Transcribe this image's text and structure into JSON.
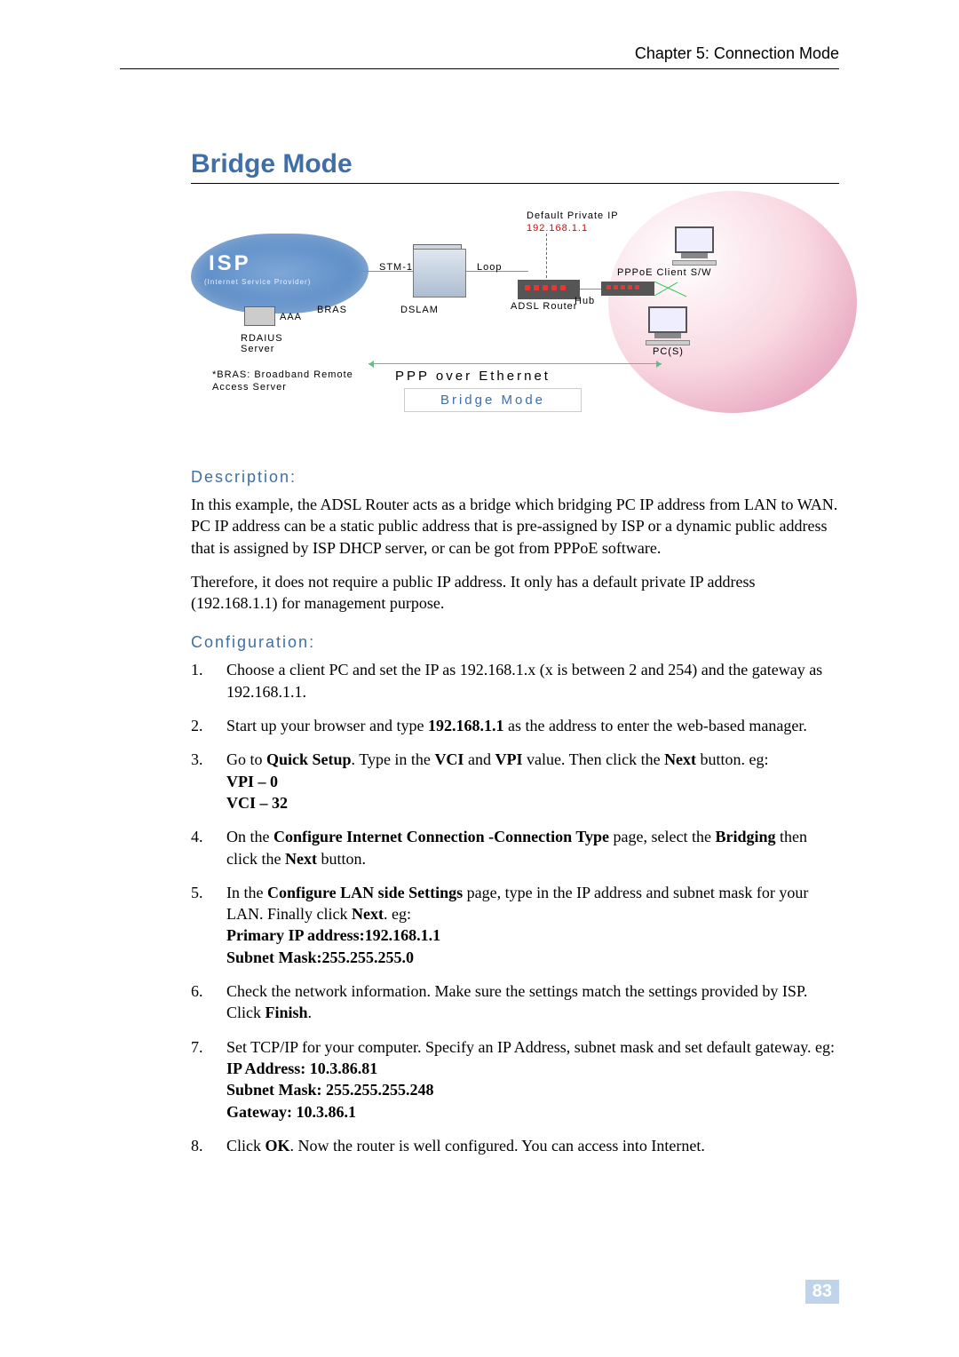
{
  "header": {
    "chapter": "Chapter 5: Connection Mode"
  },
  "section": {
    "title": "Bridge Mode"
  },
  "diagram": {
    "isp": "ISP",
    "isp_sub": "(Internet Service Provider)",
    "aaa": "AAA",
    "rdaius": "RDAIUS Server",
    "bras": "BRAS",
    "bras_note": "*BRAS: Broadband Remote Access Server",
    "stm1": "STM-1",
    "dslam": "DSLAM",
    "loop": "Loop",
    "adsl_router": "ADSL Router",
    "default_ip_label": "Default Private IP",
    "default_ip": "192.168.1.1",
    "hub": "Hub",
    "pppoe_client": "PPPoE Client S/W",
    "pcs": "PC(S)",
    "ppp_label": "PPP over Ethernet",
    "bridge_label": "Bridge Mode"
  },
  "description": {
    "heading": "Description:",
    "p1": "In this example, the ADSL Router acts as a bridge which bridging PC IP address from LAN to WAN. PC IP address can be a static public address that is pre-assigned by ISP or a dynamic public address that is assigned by ISP DHCP server, or can be got from PPPoE software.",
    "p2": "Therefore, it does not require a public IP address. It only has a default private IP address (192.168.1.1) for management purpose."
  },
  "configuration": {
    "heading": "Configuration:",
    "steps": [
      {
        "text": "Choose a client PC and set the IP as 192.168.1.x (x is between 2 and 254) and the gateway as 192.168.1.1."
      },
      {
        "pre": "Start up your browser and type ",
        "bold1": "192.168.1.1",
        "post": " as the address to enter the web-based manager."
      },
      {
        "pre": "Go to ",
        "b1": "Quick Setup",
        "mid1": ". Type in the ",
        "b2": "VCI",
        "mid2": " and ",
        "b3": "VPI",
        "mid3": " value. Then click the ",
        "b4": "Next",
        "post": " button. eg:",
        "line2": "VPI – 0",
        "line3": "VCI – 32"
      },
      {
        "pre": "On the ",
        "b1": "Configure Internet Connection -Connection Type",
        "mid1": " page, select the ",
        "b2": "Bridging",
        "mid2": " then click the ",
        "b3": "Next",
        "post": " button."
      },
      {
        "pre": "In the ",
        "b1": "Configure LAN side Settings",
        "mid1": " page, type in the IP address and subnet mask for your LAN. Finally click ",
        "b2": "Next",
        "post": ". eg:",
        "line2": "Primary IP address:192.168.1.1",
        "line3": "Subnet Mask:255.255.255.0"
      },
      {
        "pre": "Check the network information. Make sure the settings match the settings provided by ISP. Click ",
        "b1": "Finish",
        "post": "."
      },
      {
        "pre": "Set TCP/IP for your computer. Specify an IP Address, subnet mask and set default gateway. eg:",
        "line2": "IP Address: 10.3.86.81",
        "line3": "Subnet Mask: 255.255.255.248",
        "line4": "Gateway: 10.3.86.1"
      },
      {
        "pre": "Click ",
        "b1": "OK",
        "post": ". Now the router is well configured. You can access into Internet."
      }
    ]
  },
  "page_number": "83"
}
